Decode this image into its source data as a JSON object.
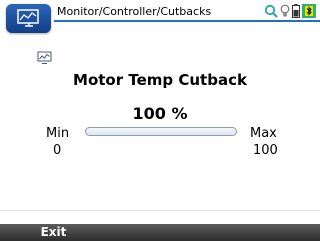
{
  "header": {
    "app_icon": "monitor-icon",
    "breadcrumb": "Monitor/Controller/Cutbacks",
    "status_icons": [
      "search-icon",
      "lightbulb-icon",
      "battery-icon",
      "bluetooth-icon"
    ],
    "accent_color": "#1e6fd0"
  },
  "main": {
    "device_icon": "monitor-small-icon",
    "title": "Motor Temp Cutback",
    "percent_text": "100 %",
    "min_label": "Min",
    "min_value": "0",
    "max_label": "Max",
    "max_value": "100",
    "bar_fill_fraction": 0.0
  },
  "footer": {
    "softkeys": [
      "Exit",
      "",
      ""
    ]
  }
}
